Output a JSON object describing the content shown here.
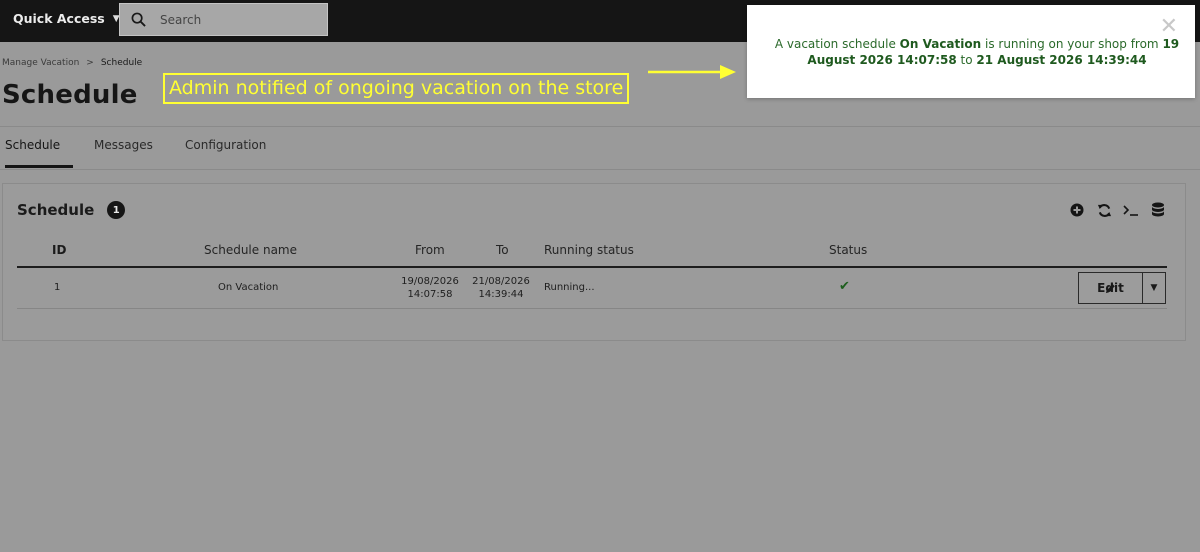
{
  "topbar": {
    "quick_access_label": "Quick Access",
    "search_placeholder": "Search"
  },
  "breadcrumb": {
    "parent": "Manage Vacation",
    "separator": ">",
    "current": "Schedule"
  },
  "page_title": "Schedule",
  "tabs": [
    {
      "label": "Schedule",
      "active": true
    },
    {
      "label": "Messages",
      "active": false
    },
    {
      "label": "Configuration",
      "active": false
    }
  ],
  "panel": {
    "title": "Schedule",
    "count": "1",
    "toolbar_icons": [
      "add-circle-icon",
      "refresh-icon",
      "terminal-icon",
      "database-icon"
    ]
  },
  "table": {
    "headers": {
      "id": "ID",
      "name": "Schedule name",
      "from": "From",
      "to": "To",
      "running": "Running status",
      "status": "Status"
    },
    "rows": [
      {
        "id": "1",
        "name": "On Vacation",
        "from_date": "19/08/2026",
        "from_time": "14:07:58",
        "to_date": "21/08/2026",
        "to_time": "14:39:44",
        "running": "Running...",
        "status_icon": "check-icon",
        "edit_label": "Edit"
      }
    ]
  },
  "annotation": {
    "text": "Admin notified of ongoing vacation on the store",
    "color": "#ffff33"
  },
  "notification": {
    "part1": "A vacation schedule ",
    "schedule_name": "On Vacation",
    "part2": " is running on your shop from ",
    "from": "19 August 2026 14:07:58",
    "part3": " to ",
    "to": "21 August 2026 14:39:44",
    "color": "#2b6a2b"
  }
}
